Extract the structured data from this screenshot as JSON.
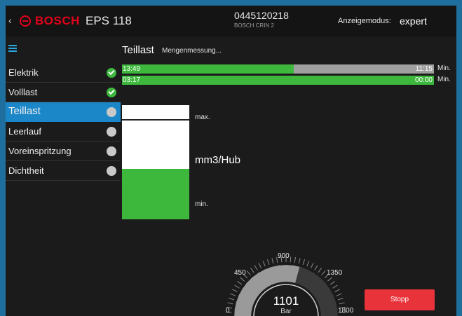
{
  "header": {
    "back_icon": "chevron-left-icon",
    "brand_icon": "bosch-logo-icon",
    "brand": "BOSCH",
    "product": "EPS 118",
    "part_number": "0445120218",
    "part_sub": "BOSCH CRIN 2",
    "mode_label": "Anzeigemodus:",
    "mode_value": "expert"
  },
  "page": {
    "menu_icon": "menu-icon",
    "title": "Teillast",
    "subtitle": "Mengenmessung..."
  },
  "sidebar": {
    "items": [
      {
        "label": "Elektrik",
        "status": "done"
      },
      {
        "label": "Volllast",
        "status": "done"
      },
      {
        "label": "Teillast",
        "status": "pending",
        "active": true
      },
      {
        "label": "Leerlauf",
        "status": "pending"
      },
      {
        "label": "Voreinspritzung",
        "status": "pending"
      },
      {
        "label": "Dichtheit",
        "status": "pending"
      }
    ]
  },
  "timers": [
    {
      "elapsed": "13:49",
      "total": "11:15",
      "unit": "Min.",
      "progress": 0.55
    },
    {
      "elapsed": "03:17",
      "total": "00:00",
      "unit": "Min.",
      "progress": 1.0
    }
  ],
  "quantity": {
    "max_label": "max.",
    "unit_label": "mm3/Hub",
    "min_label": "min.",
    "level": 0.44
  },
  "pressure": {
    "value": "1101",
    "unit": "Bar",
    "ticks": [
      "0",
      "450",
      "900",
      "1350",
      "1800"
    ],
    "level": 0.61
  },
  "actions": {
    "stop_label": "Stopp"
  },
  "colors": {
    "accent_blue": "#1b87c8",
    "ok_green": "#3db83d",
    "stop_red": "#e8333a",
    "brand_red": "#e2001a"
  }
}
